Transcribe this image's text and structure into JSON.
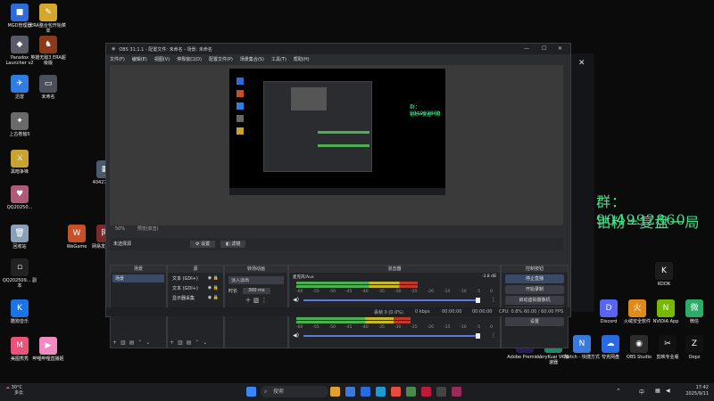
{
  "desktop": {
    "icons_left": [
      {
        "label": "MGD管理器",
        "color": "#2d6bd8",
        "glyph": "■"
      },
      {
        "label": "ERA整合包开始菜单",
        "color": "#d4a82a",
        "glyph": "✎"
      },
      {
        "label": "Paradox Launcher v2",
        "color": "#5a5a66",
        "glyph": "◆"
      },
      {
        "label": "英雄无敌3 ERA超级版",
        "color": "#8a3a1a",
        "glyph": "♞"
      },
      {
        "label": "迅雷",
        "color": "#2f7de1",
        "glyph": "✈"
      },
      {
        "label": "未命名",
        "color": "#4a4f5a",
        "glyph": "▭"
      },
      {
        "label": "上古卷轴5",
        "color": "#6a6a6a",
        "glyph": "✦"
      },
      {
        "label": "黑暗争锋",
        "color": "#c9a230",
        "glyph": "⚔"
      },
      {
        "label": "QQ20250...",
        "color": "#b05a7a",
        "glyph": "♥"
      },
      {
        "label": "回收站",
        "color": "#8aa0b8",
        "glyph": "🗑"
      },
      {
        "label": "QQ202509... 副本",
        "color": "#222",
        "glyph": "▫"
      },
      {
        "label": "酷狗音乐",
        "color": "#1a74e8",
        "glyph": "K"
      },
      {
        "label": "美图秀秀",
        "color": "#e8547a",
        "glyph": "M"
      },
      {
        "label": "哔哩哔哩直播姬",
        "color": "#f08ac0",
        "glyph": "▶"
      },
      {
        "label": "WeGame",
        "color": "#c5502a",
        "glyph": "W"
      },
      {
        "label": "网易发烧游戏",
        "color": "#7a2a2a",
        "glyph": "网"
      },
      {
        "label": "404274561",
        "color": "#4a5a6a",
        "glyph": "▦"
      }
    ],
    "icons_right": [
      {
        "label": "KOOK",
        "color": "#1c1c1c",
        "glyph": "K"
      },
      {
        "label": "Discord",
        "color": "#5865f2",
        "glyph": "D"
      },
      {
        "label": "火绒安全软件",
        "color": "#e08a1a",
        "glyph": "火"
      },
      {
        "label": "NVIDIA App",
        "color": "#76b900",
        "glyph": "N"
      },
      {
        "label": "微信",
        "color": "#2aae67",
        "glyph": "微"
      },
      {
        "label": "Adobe Premie...",
        "color": "#2a1a5a",
        "glyph": "Pr"
      },
      {
        "label": "VeryKuai VK加速器",
        "color": "#1a8a6a",
        "glyph": "V"
      },
      {
        "label": "Netch - 快捷方式",
        "color": "#3a7ad8",
        "glyph": "N"
      },
      {
        "label": "夸克网盘",
        "color": "#2a6ae0",
        "glyph": "☁"
      },
      {
        "label": "OBS Studio",
        "color": "#2b2b2b",
        "glyph": "◉"
      },
      {
        "label": "剪映专业版",
        "color": "#111",
        "glyph": "✂"
      },
      {
        "label": "Oopz",
        "color": "#111",
        "glyph": "Z"
      }
    ],
    "overlay_line1": "群：904992860",
    "overlay_line2": "钻粉=复盘一局"
  },
  "obs": {
    "title": "OBS 31.1.1 - 配置文件: 未命名 - 场景: 未命名",
    "menu": [
      "文件(F)",
      "编辑(E)",
      "视图(V)",
      "停靠窗口(D)",
      "配置文件(P)",
      "场景集合(S)",
      "工具(T)",
      "帮助(H)"
    ],
    "zoom": "50%",
    "preview_label": "预览(双击)",
    "source_hint": "未选择源",
    "props_button": "⚙ 设置",
    "filters_button": "◧ 滤镜",
    "docks": {
      "scenes": {
        "title": "场景",
        "items": [
          "场景"
        ]
      },
      "sources": {
        "title": "源",
        "items": [
          "文本 (GDI+)",
          "文本 (GDI+)",
          "显示器采集"
        ]
      },
      "transitions": {
        "title": "转场动画",
        "type": "淡入淡出",
        "duration_label": "时长",
        "duration": "300 ms"
      },
      "mixer": {
        "title": "混音器",
        "channels": [
          {
            "name": "麦克风/Aux",
            "db": "-3.8 dB",
            "level": 0.62
          },
          {
            "name": "桌面音频",
            "db": "-2.1 dB",
            "level": 0.58
          }
        ],
        "scale": [
          "-60",
          "-55",
          "-50",
          "-45",
          "-40",
          "-35",
          "-30",
          "-25",
          "-20",
          "-15",
          "-10",
          "-5",
          "0"
        ]
      },
      "controls": {
        "title": "控制按钮",
        "buttons": [
          "停止直播",
          "开始录制",
          "启动虚拟摄像机",
          "工作室模式",
          "设置"
        ]
      }
    },
    "status": {
      "dropped": "丢帧 0 (0.0%)",
      "bitrate": "0 kbps",
      "stream_time": "00:00:00",
      "rec_time": "00:00:00",
      "cpu": "CPU: 0.8%",
      "fps": "60.00 / 60.00 FPS"
    }
  },
  "taskbar": {
    "weather_temp": "30°C",
    "weather_desc": "多云",
    "search_placeholder": "搜索",
    "ime": "中",
    "time": "17:42",
    "date": "2025/9/11"
  }
}
